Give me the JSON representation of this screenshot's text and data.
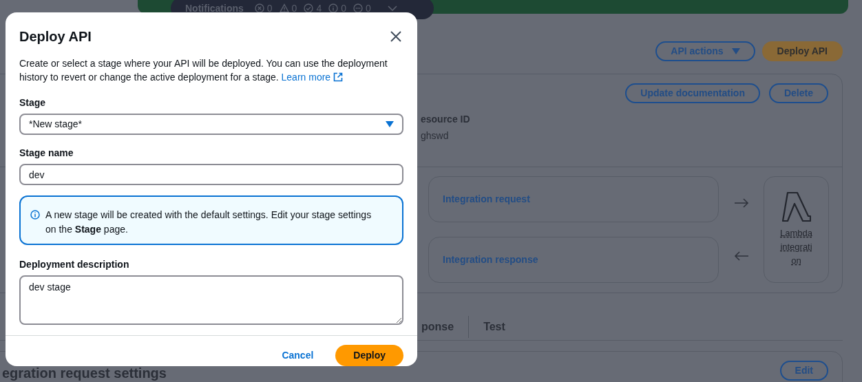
{
  "notifications": {
    "title": "Notifications",
    "counts": [
      {
        "kind": "error",
        "count": "0"
      },
      {
        "kind": "warning",
        "count": "0"
      },
      {
        "kind": "success",
        "count": "4"
      },
      {
        "kind": "info",
        "count": "0"
      },
      {
        "kind": "pending",
        "count": "0"
      }
    ]
  },
  "page_actions": {
    "api_actions": "API actions",
    "deploy": "Deploy API"
  },
  "resource_card": {
    "buttons": [
      "Update documentation",
      "Delete"
    ],
    "field_label": "esource ID",
    "field_value": "ghswd",
    "integration_request": "Integration request",
    "integration_response": "Integration response",
    "lambda_label": "Lambda integration"
  },
  "tabs": [
    "ponse",
    "Test"
  ],
  "settings_section": {
    "title": "egration request settings",
    "edit": "Edit"
  },
  "modal": {
    "title": "Deploy API",
    "description": "Create or select a stage where your API will be deployed. You can use the deployment history to revert or change the active deployment for a stage.",
    "link": "Learn more",
    "stage_label": "Stage",
    "stage_value": "*New stage*",
    "stage_name_label": "Stage name",
    "stage_name_value": "dev",
    "info": "A new stage will be created with the default settings. Edit your stage settings on the **Stage** page.",
    "description_label": "Deployment description",
    "description_value": "dev stage",
    "cancel": "Cancel",
    "deploy": "Deploy"
  }
}
